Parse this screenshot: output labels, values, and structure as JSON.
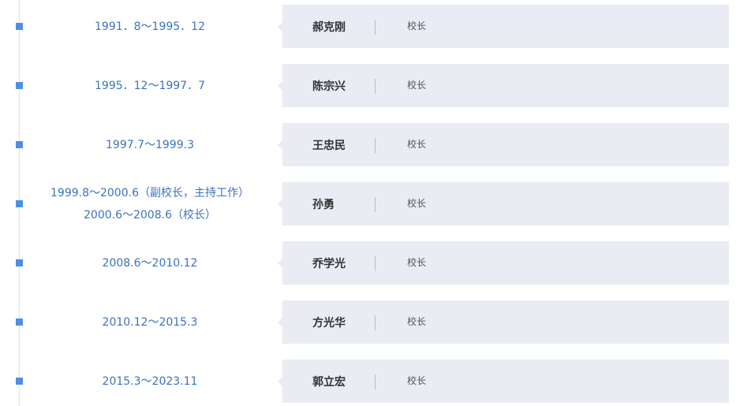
{
  "timeline": {
    "entries": [
      {
        "period": "1991．8～1995．12",
        "name": "郝克刚",
        "title": "校长"
      },
      {
        "period": "1995．12～1997．7",
        "name": "陈宗兴",
        "title": "校长"
      },
      {
        "period": "1997.7～1999.3",
        "name": "王忠民",
        "title": "校长"
      },
      {
        "period": "1999.8～2000.6（副校长，主持工作） 2000.6～2008.6（校长）",
        "name": "孙勇",
        "title": "校长"
      },
      {
        "period": "2008.6～2010.12",
        "name": "乔学光",
        "title": "校长"
      },
      {
        "period": "2010.12～2015.3",
        "name": "方光华",
        "title": "校长"
      },
      {
        "period": "2015.3～2023.11",
        "name": "郭立宏",
        "title": "校长"
      }
    ]
  },
  "colors": {
    "accent": "#4f8fe3",
    "period_text": "#3a72c0",
    "card_background": "#e9ecf3",
    "name_text": "#333333"
  }
}
